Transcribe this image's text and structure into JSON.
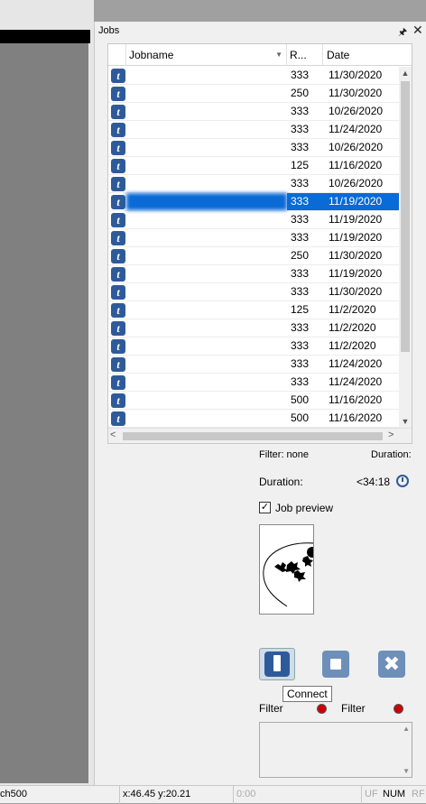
{
  "panel": {
    "title": "Jobs",
    "pin_icon": "pin-icon",
    "close_icon": "close-icon"
  },
  "grid": {
    "columns": {
      "name": "Jobname",
      "res": "R...",
      "date": "Date"
    },
    "rows": [
      {
        "name": "",
        "res": "333",
        "date": "11/30/2020"
      },
      {
        "name": "",
        "res": "250",
        "date": "11/30/2020"
      },
      {
        "name": "",
        "res": "333",
        "date": "10/26/2020"
      },
      {
        "name": "",
        "res": "333",
        "date": "11/24/2020"
      },
      {
        "name": "",
        "res": "333",
        "date": "10/26/2020"
      },
      {
        "name": "",
        "res": "125",
        "date": "11/16/2020"
      },
      {
        "name": "",
        "res": "333",
        "date": "10/26/2020"
      },
      {
        "name": "",
        "res": "333",
        "date": "11/19/2020",
        "selected": true
      },
      {
        "name": "",
        "res": "333",
        "date": "11/19/2020"
      },
      {
        "name": "",
        "res": "333",
        "date": "11/19/2020"
      },
      {
        "name": "",
        "res": "250",
        "date": "11/30/2020"
      },
      {
        "name": "",
        "res": "333",
        "date": "11/19/2020"
      },
      {
        "name": "",
        "res": "333",
        "date": "11/30/2020"
      },
      {
        "name": "",
        "res": "125",
        "date": "11/2/2020"
      },
      {
        "name": "",
        "res": "333",
        "date": "11/2/2020"
      },
      {
        "name": "",
        "res": "333",
        "date": "11/2/2020"
      },
      {
        "name": "",
        "res": "333",
        "date": "11/24/2020"
      },
      {
        "name": "",
        "res": "333",
        "date": "11/24/2020"
      },
      {
        "name": "",
        "res": "500",
        "date": "11/16/2020"
      },
      {
        "name": "",
        "res": "500",
        "date": "11/16/2020"
      }
    ]
  },
  "info": {
    "filter": "Filter: none",
    "duration_cut": "Duration:",
    "duration_label": "Duration:",
    "duration_value": "<34:18",
    "job_preview": "Job preview",
    "job_preview_checked": true
  },
  "controls": {
    "connect_tooltip": "Connect",
    "filter1_label": "Filter",
    "filter2_label": "Filter"
  },
  "statusbar": {
    "left": "ch500",
    "coords": "x:46.45   y:20.21",
    "time": "0:00",
    "uf": "UF",
    "num": "NUM",
    "rf": "RF"
  },
  "colors": {
    "selection": "#0a6ad6",
    "accent": "#2f5a9a",
    "led": "#cc0000"
  }
}
